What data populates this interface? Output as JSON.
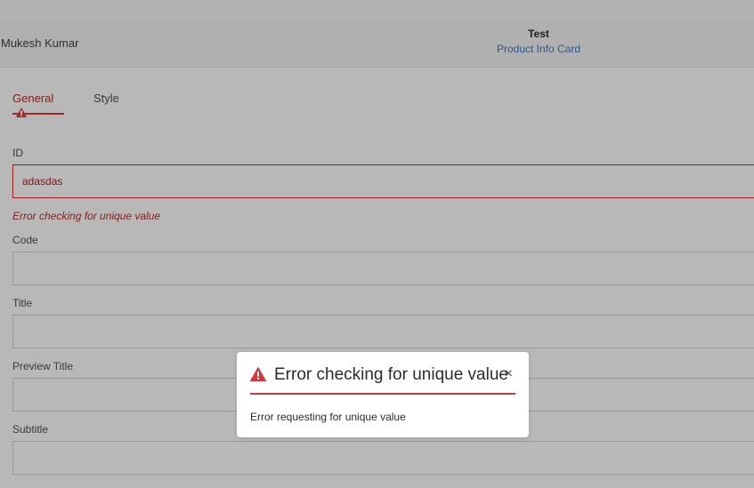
{
  "header": {
    "author": "Mukesh Kumar",
    "title": "Test",
    "subtitle": "Product Info Card"
  },
  "tabs": [
    {
      "label": "General",
      "active": true,
      "has_warning": true
    },
    {
      "label": "Style",
      "active": false
    }
  ],
  "form": {
    "id": {
      "label": "ID",
      "value": "adasdas",
      "error": "Error checking for unique value"
    },
    "code": {
      "label": "Code",
      "value": ""
    },
    "title": {
      "label": "Title",
      "value": ""
    },
    "preview_title": {
      "label": "Preview Title",
      "value": ""
    },
    "subtitle": {
      "label": "Subtitle",
      "value": ""
    }
  },
  "dialog": {
    "title": "Error checking for unique value",
    "message": "Error requesting for unique value",
    "close_glyph": "×",
    "icon": "alert-icon"
  },
  "colors": {
    "error": "#d7373f",
    "link": "#2f5691",
    "overlay": "#b8b8b8"
  }
}
